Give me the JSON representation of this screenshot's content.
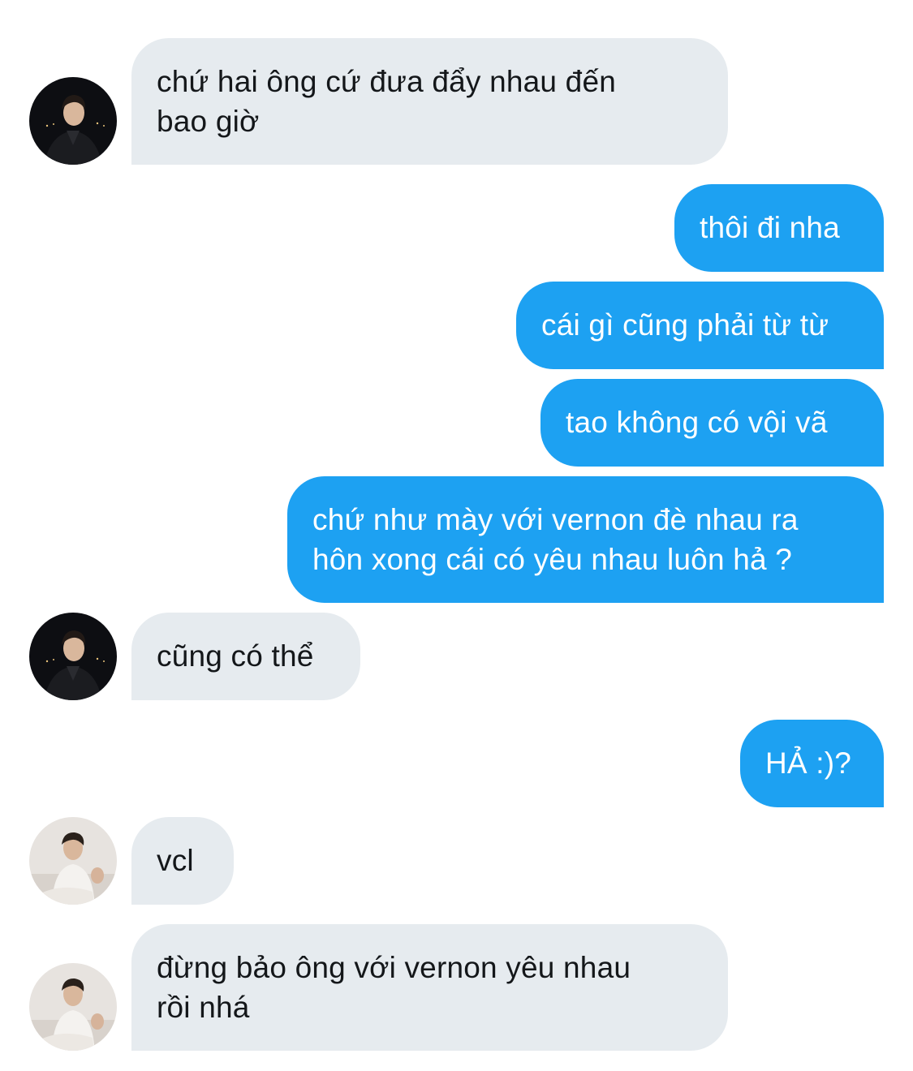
{
  "colors": {
    "incoming_bubble": "#e6ebef",
    "outgoing_bubble": "#1da1f2",
    "incoming_text": "#14171a",
    "outgoing_text": "#ffffff"
  },
  "avatars": {
    "dark": "avatar-dark-jacket-night",
    "light": "avatar-white-shirt-sitting"
  },
  "messages": [
    {
      "side": "incoming",
      "avatar": "dark",
      "text": "chứ hai ông cứ đưa đẩy nhau đến\nbao giờ"
    },
    {
      "side": "outgoing",
      "text": "thôi đi nha"
    },
    {
      "side": "outgoing",
      "text": "cái gì cũng phải từ từ"
    },
    {
      "side": "outgoing",
      "text": "tao không có vội vã"
    },
    {
      "side": "outgoing",
      "text": "chứ như mày với vernon đè nhau ra\nhôn xong cái có yêu nhau luôn hả ?"
    },
    {
      "side": "incoming",
      "avatar": "dark",
      "text": "cũng có thể"
    },
    {
      "side": "outgoing",
      "text": "HẢ :)?"
    },
    {
      "side": "incoming",
      "avatar": "light",
      "text": "vcl"
    },
    {
      "side": "incoming",
      "avatar": "light",
      "text": "đừng bảo ông với vernon yêu nhau\nrồi nhá"
    }
  ]
}
